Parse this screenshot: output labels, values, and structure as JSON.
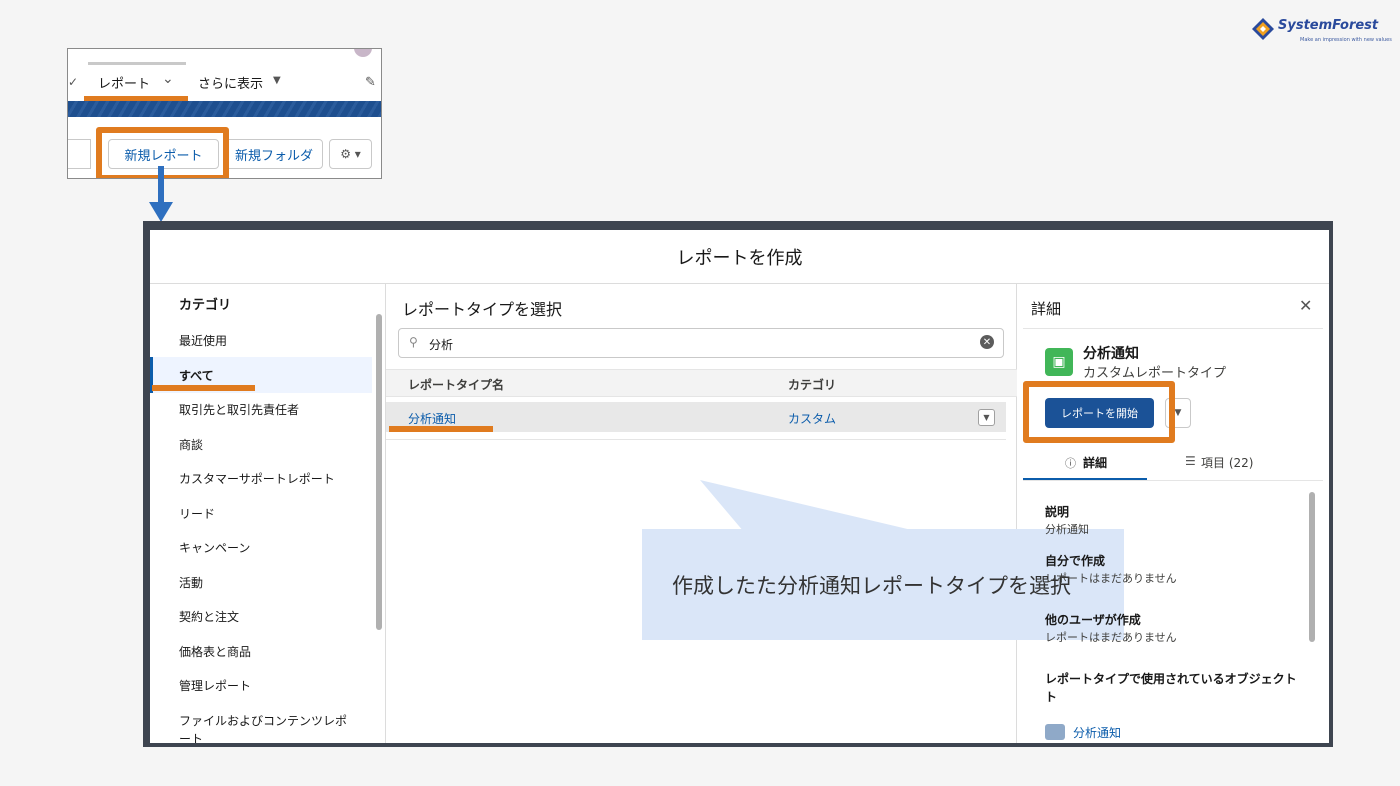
{
  "logo": {
    "name": "SystemForest",
    "tagline": "Make an impression with new values"
  },
  "crop": {
    "tab_label": "レポート",
    "more_label": "さらに表示",
    "new_report_button": "新規レポート",
    "new_folder_button": "新規フォルダ",
    "gear_menu": "⚙ ▾"
  },
  "modal": {
    "title": "レポートを作成",
    "categories": {
      "heading": "カテゴリ",
      "items": [
        "最近使用",
        "すべて",
        "取引先と取引先責任者",
        "商談",
        "カスタマーサポートレポート",
        "リード",
        "キャンペーン",
        "活動",
        "契約と注文",
        "価格表と商品",
        "管理レポート",
        "ファイルおよびコンテンツレポ",
        "ート"
      ],
      "selected": "すべて"
    },
    "types": {
      "heading": "レポートタイプを選択",
      "search_value": "分析",
      "columns": [
        "レポートタイプ名",
        "カテゴリ"
      ],
      "rows": [
        {
          "name": "分析通知",
          "category": "カスタム"
        }
      ]
    },
    "callout": "作成したた分析通知レポートタイプを選択",
    "details": {
      "heading": "詳細",
      "type_name": "分析通知",
      "type_kind": "カスタムレポートタイプ",
      "start_button": "レポートを開始",
      "tab_details": "詳細",
      "tab_fields": "項目 (22)",
      "sections": [
        {
          "label": "説明",
          "value": "分析通知"
        },
        {
          "label": "自分で作成",
          "value": "レポートはまだありません"
        },
        {
          "label": "他のユーザが作成",
          "value": "レポートはまだありません"
        },
        {
          "label": "レポートタイプで使用されているオブジェクト",
          "value": ""
        }
      ],
      "object_line2": "ト",
      "object_name": "分析通知"
    }
  },
  "colors": {
    "highlight": "#e07b1f",
    "brand_blue": "#1b5297",
    "arrow": "#2e6fbf",
    "callout_bg": "#dae6f8"
  }
}
